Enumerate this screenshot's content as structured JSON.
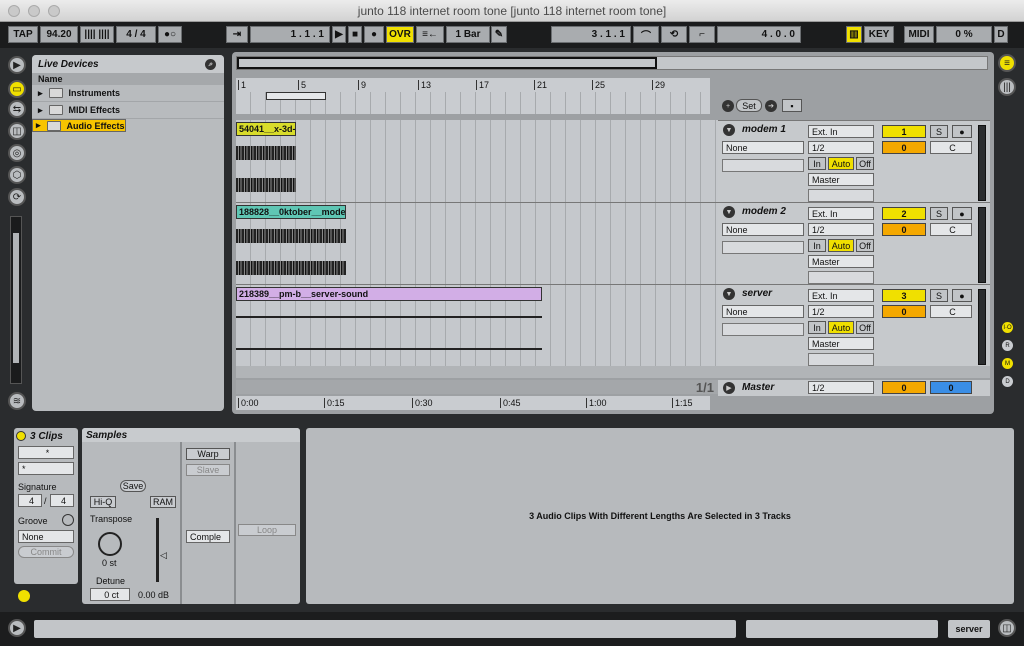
{
  "window": {
    "title": "junto 118 internet room tone  [junto 118 internet room tone]"
  },
  "transport": {
    "tap": "TAP",
    "tempo": "94.20",
    "time_sig": "4 / 4",
    "loop_icon": "●○",
    "follow_icon": "⇥",
    "position": "1 .  1 .  1",
    "ovr": "OVR",
    "quantize": "1 Bar",
    "loop_start": "3 .  1 .  1",
    "loop_length": "4 .  0 .  0",
    "key": "KEY",
    "midi": "MIDI",
    "cpu": "0 %",
    "d": "D"
  },
  "browser": {
    "title": "Live Devices",
    "column": "Name",
    "items": [
      {
        "label": "Instruments"
      },
      {
        "label": "MIDI Effects"
      },
      {
        "label": "Audio Effects"
      }
    ]
  },
  "ruler": {
    "bars": [
      "1",
      "5",
      "9",
      "13",
      "17",
      "21",
      "25",
      "29"
    ]
  },
  "set_label": "Set",
  "tracks": [
    {
      "name": "modem 1",
      "clip": "54041__x-3d-",
      "input": "Ext. In",
      "channel": "1/2",
      "fx": "None",
      "output": "Master",
      "number": "1",
      "vol": "0",
      "pan": "C",
      "color": "#d8dc2a"
    },
    {
      "name": "modem 2",
      "clip": "188828__0ktober__mode",
      "input": "Ext. In",
      "channel": "1/2",
      "fx": "None",
      "output": "Master",
      "number": "2",
      "vol": "0",
      "pan": "C",
      "color": "#5fc6b4"
    },
    {
      "name": "server",
      "clip": "218389__pm-b__server-sound",
      "input": "Ext. In",
      "channel": "1/2",
      "fx": "None",
      "output": "Master",
      "number": "3",
      "vol": "0",
      "pan": "C",
      "color": "#d2aee6"
    }
  ],
  "monitor": {
    "in": "In",
    "auto": "Auto",
    "off": "Off",
    "solo": "S"
  },
  "master": {
    "name": "Master",
    "channel": "1/2",
    "vol": "0",
    "pan": "0",
    "page": "1/1"
  },
  "timeline": [
    "0:00",
    "0:15",
    "0:30",
    "0:45",
    "1:00",
    "1:15"
  ],
  "clip_panel": {
    "title": "3 Clips",
    "sel1": "*",
    "sel2": "*",
    "signature_label": "Signature",
    "sig_num": "4",
    "sig_den": "4",
    "groove_label": "Groove",
    "groove_value": "None",
    "commit": "Commit"
  },
  "sample_panel": {
    "title": "Samples",
    "save": "Save",
    "hiq": "Hi-Q",
    "ram": "RAM",
    "transpose_label": "Transpose",
    "transpose_value": "0 st",
    "detune_label": "Detune",
    "detune_value": "0 ct",
    "gain_value": "0.00 dB",
    "warp": "Warp",
    "slave": "Slave",
    "warp_mode": "Comple",
    "loop": "Loop"
  },
  "info": {
    "text": "3 Audio Clips With Different Lengths Are Selected in 3 Tracks"
  },
  "status": {
    "track": "server"
  }
}
